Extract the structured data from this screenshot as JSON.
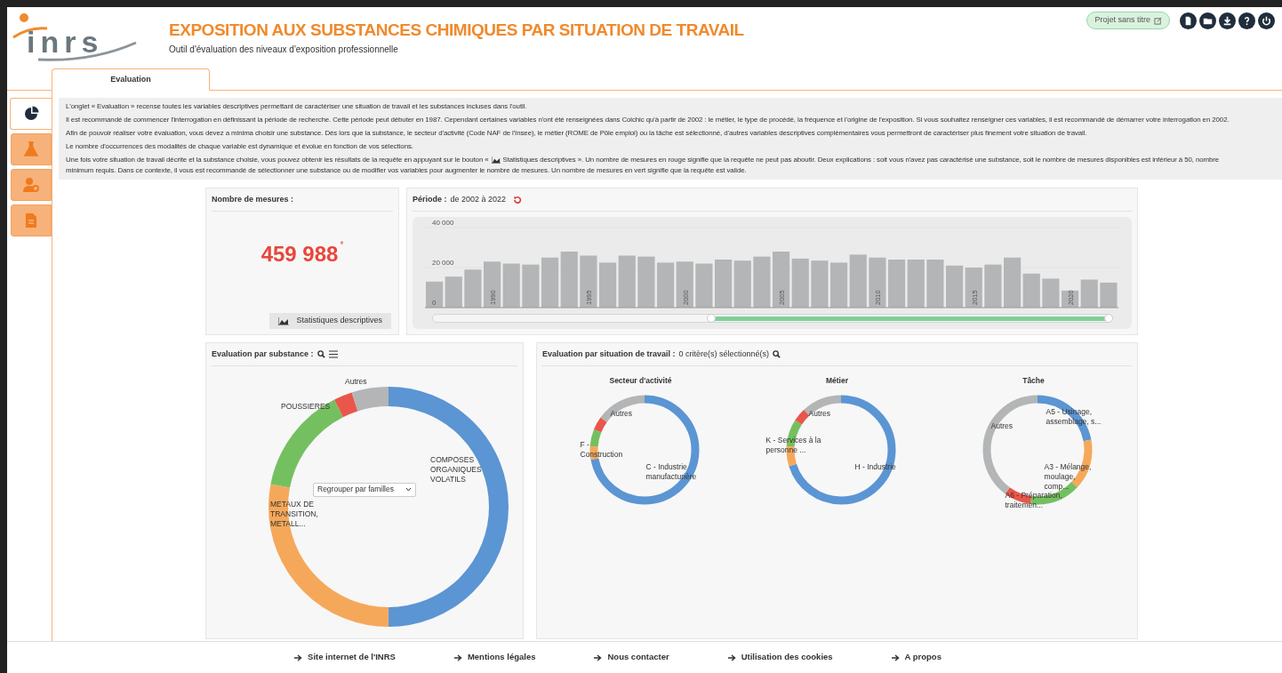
{
  "header": {
    "logo": "inrs",
    "title": "EXPOSITION AUX SUBSTANCES CHIMIQUES PAR SITUATION DE TRAVAIL",
    "subtitle": "Outil d'évaluation des niveaux d'exposition professionnelle",
    "project": "Projet sans titre"
  },
  "tabs": [
    {
      "label": "Evaluation",
      "selected": true
    }
  ],
  "side_tabs": [
    {
      "kind": "chart",
      "selected": true
    },
    {
      "kind": "flask",
      "selected": false
    },
    {
      "kind": "user-settings",
      "selected": false
    },
    {
      "kind": "document",
      "selected": false
    }
  ],
  "info": [
    "L'onglet « Evaluation » recense toutes les variables descriptives permettant de caractériser une situation de travail et les substances incluses dans l'outil.",
    "Il est recommandé de commencer l'interrogation en définissant la période de recherche. Cette période peut débuter en 1987. Cependant certaines variables n'ont été renseignées dans Colchic qu'à partir de 2002 : le métier, le type de procédé, la fréquence et l'origine de l'exposition. Si vous souhaitez renseigner ces variables, il est recommandé de démarrer votre interrogation en 2002.",
    "Afin de pouvoir réaliser votre évaluation, vous devez a minima choisir une substance. Dès lors que la substance, le secteur d'activité (Code NAF de l'Insee), le métier (ROME de Pôle emploi) ou la tâche est sélectionné, d'autres variables descriptives complémentaires vous permettront de caractériser plus finement votre situation de travail.",
    "Le nombre d'occurrences des modalités de chaque variable est dynamique et évolue en fonction de vos sélections."
  ],
  "info_last": {
    "before": "Une fois votre situation de travail décrite et la substance choisie, vous pouvez obtenir les résultats de la requête en appuyant sur le bouton «",
    "after": "Statistiques descriptives ». Un nombre de mesures en rouge signifie que la requête ne peut pas aboutir. Deux explications : soit vous n'avez pas caractérisé une substance, soit le nombre de mesures disponibles est inférieur à 50, nombre",
    "continuation": "minimum requis. Dans ce contexte, il vous est recommandé de sélectionner une substance ou de modifier vos variables pour augmenter le nombre de mesures. Un nombre de mesures en vert signifie que la requête est valide."
  },
  "measures": {
    "title": "Nombre de mesures :",
    "value": "459 988",
    "mark": "*",
    "button": "Statistiques descriptives"
  },
  "period": {
    "label": "Période :",
    "range": "de 2002 à 2022",
    "slider": {
      "level": 0.59
    },
    "chart_data": {
      "type": "bar",
      "x": [
        1987,
        1988,
        1989,
        1990,
        1991,
        1992,
        1993,
        1994,
        1995,
        1996,
        1997,
        1998,
        1999,
        2000,
        2001,
        2002,
        2003,
        2004,
        2005,
        2006,
        2007,
        2008,
        2009,
        2010,
        2011,
        2012,
        2013,
        2014,
        2015,
        2016,
        2017,
        2018,
        2019,
        2020,
        2021,
        2022
      ],
      "values": [
        13000,
        15500,
        19000,
        23000,
        22000,
        21500,
        25000,
        28000,
        26000,
        22500,
        26000,
        25500,
        22500,
        23000,
        22000,
        24000,
        23500,
        25500,
        28000,
        24500,
        23500,
        22500,
        26500,
        25000,
        24000,
        24000,
        24000,
        21000,
        20000,
        21500,
        25000,
        17000,
        14500,
        8500,
        14000,
        12500
      ],
      "xlim": [
        1986.5,
        2022.5
      ],
      "ylim": [
        0,
        40000
      ],
      "yticks": [
        {
          "value": 0,
          "label": "0"
        },
        {
          "value": 20000,
          "label": "20 000"
        },
        {
          "value": 40000,
          "label": "40 000"
        }
      ],
      "xticks": [
        1990,
        1995,
        2000,
        2005,
        2010,
        2015,
        2020
      ]
    }
  },
  "substance": {
    "title": "Evaluation par substance :",
    "group_select": "Regrouper par familles",
    "labels": [
      "Autres",
      "POUSSIERES",
      "COMPOSES ORGANIQUES VOLATILS",
      "METAUX DE TRANSITION, METALL..."
    ]
  },
  "situation": {
    "title": "Evaluation par situation de travail :",
    "criteria": "0 critère(s) sélectionné(s)",
    "donuts": [
      {
        "title": "Secteur d'activité",
        "labels": [
          "Autres",
          "F - Construction",
          "C - Industrie manufacturière"
        ]
      },
      {
        "title": "Métier",
        "labels": [
          "Autres",
          "K - Services à la personne ...",
          "H - Industrie"
        ]
      },
      {
        "title": "Tâche",
        "labels": [
          "Autres",
          "A5 - Usinage, assemblage, s...",
          "A3 - Mélange, moulage, comp...",
          "A6 - Préparation, traitemen..."
        ]
      }
    ]
  },
  "footer": [
    "Site internet de l'INRS",
    "Mentions légales",
    "Nous contacter",
    "Utilisation des cookies",
    "A propos"
  ]
}
